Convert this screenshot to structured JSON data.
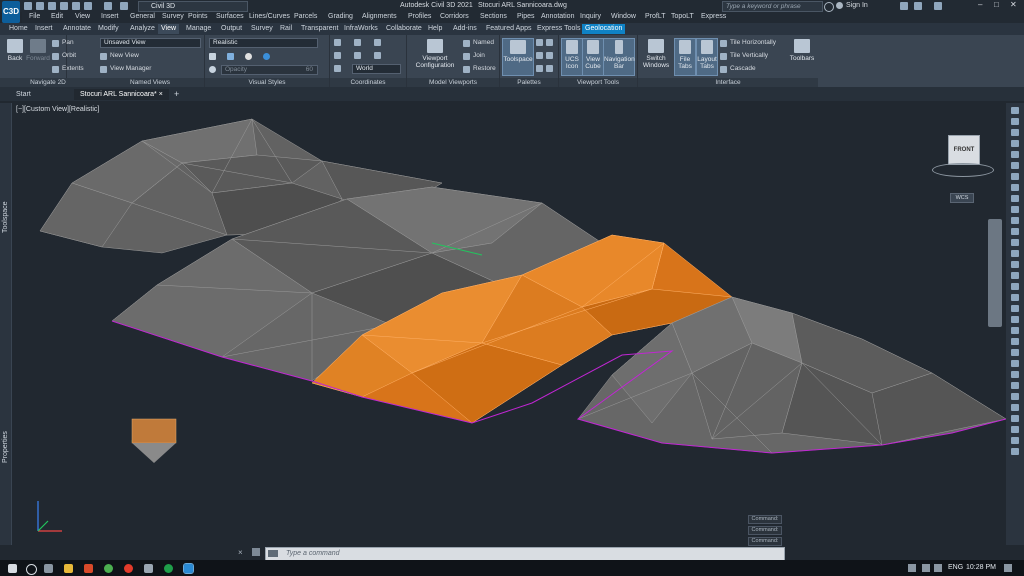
{
  "app": {
    "logo": "C3D",
    "title": "Autodesk Civil 3D 2021",
    "file": "Stocuri ARL Sannicoara.dwg",
    "workspace": "Civil 3D",
    "search_placeholder": "Type a keyword or phrase",
    "sign_in": "Sign In"
  },
  "menu": [
    "File",
    "Edit",
    "View",
    "Insert",
    "General",
    "Survey",
    "Points",
    "Surfaces",
    "Lines/Curves",
    "Parcels",
    "Grading",
    "Alignments",
    "Profiles",
    "Corridors",
    "Sections",
    "Pipes",
    "Annotation",
    "Inquiry",
    "Window",
    "ProfLT",
    "TopoLT",
    "Express"
  ],
  "ribbon_tabs": [
    "Home",
    "Insert",
    "Annotate",
    "Modify",
    "Analyze",
    "View",
    "Manage",
    "Output",
    "Survey",
    "Rail",
    "Transparent",
    "InfraWorks",
    "Collaborate",
    "Help",
    "Add-ins",
    "Featured Apps",
    "Express Tools",
    "Geolocation"
  ],
  "ribbon": {
    "navigate": {
      "title": "Navigate 2D",
      "back": "Back",
      "forward": "Forward",
      "pan": "Pan",
      "orbit": "Orbit",
      "extents": "Extents"
    },
    "named_views": {
      "title": "Named Views",
      "current": "Unsaved View",
      "new_view": "New View",
      "manager": "View Manager"
    },
    "visual_styles": {
      "title": "Visual Styles",
      "current": "Realistic",
      "opacity": "Opacity",
      "opacity_value": "60"
    },
    "coordinates": {
      "title": "Coordinates",
      "ucs": "World"
    },
    "model_viewports": {
      "title": "Model Viewports",
      "config": "Viewport Configuration",
      "named": "Named",
      "join": "Join",
      "restore": "Restore"
    },
    "palettes": {
      "title": "Palettes",
      "toolspace": "Toolspace"
    },
    "viewport_tools": {
      "title": "Viewport Tools",
      "ucs_icon": "UCS Icon",
      "view_cube": "View Cube",
      "nav_bar": "Navigation Bar"
    },
    "interface": {
      "title": "Interface",
      "switch": "Switch Windows",
      "file_tabs": "File Tabs",
      "layout_tabs": "Layout Tabs",
      "tile_h": "Tile Horizontally",
      "tile_v": "Tile Vertically",
      "cascade": "Cascade",
      "toolbars": "Toolbars"
    }
  },
  "doc_tabs": [
    "Start",
    "Stocuri ARL Sannicoara*"
  ],
  "viewport": {
    "label": "[−][Custom View][Realistic]",
    "viewcube_face": "FRONT",
    "wcs": "WCS"
  },
  "side": {
    "toolspace": "Toolspace",
    "properties": "Properties"
  },
  "command": {
    "placeholder": "Type a command",
    "history": [
      "Command:",
      "Command:",
      "Command:"
    ]
  },
  "taskbar": {
    "lang": "ENG",
    "time": "10:28 PM"
  },
  "colors": {
    "accent": "#0f82c5",
    "surface_gray": "#6e6e6e",
    "stockpile_orange": "#e07b14",
    "boundary": "#c026d3"
  }
}
